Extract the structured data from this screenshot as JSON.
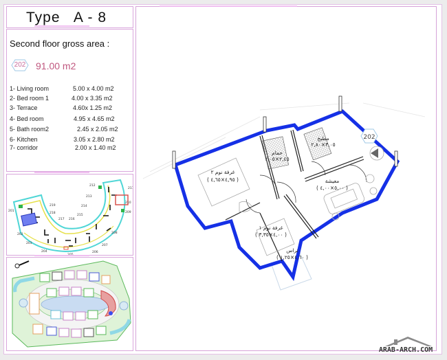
{
  "header": {
    "title": "Type   A - 8"
  },
  "area": {
    "heading": "Second floor gross area :",
    "unit_badge": "202",
    "gross_area": "91.00 m2"
  },
  "rooms": [
    {
      "label": "1- Living room",
      "dims": "5.00 x 4.00 m2"
    },
    {
      "label": "2- Bed room 1",
      "dims": "4.00 x 3.35 m2"
    },
    {
      "label": "3- Terrace",
      "dims": "4.60x 1.25 m2"
    },
    {
      "label": "4- Bed room",
      "dims": "4.95 x 4.65 m2"
    },
    {
      "label": "5- Bath room2",
      "dims": "2.45 x 2.05 m2"
    },
    {
      "label": "6- Kitchen",
      "dims": "3.05 x 2.80 m2"
    },
    {
      "label": "7- corridor",
      "dims": "2.00 x 1.40 m2"
    }
  ],
  "keyplan": {
    "unit_labels": [
      "201",
      "202",
      "203",
      "204",
      "205",
      "206",
      "207",
      "208",
      "209",
      "210",
      "211",
      "212",
      "213",
      "214",
      "215",
      "216",
      "217",
      "218",
      "219"
    ],
    "highlighted_unit": "202",
    "colors": {
      "unit_highlight": "#6f7ef0",
      "ring_outer": "#4fd6d6",
      "ring_inner": "#e6e04a",
      "walls": "#111111",
      "accent_red": "#d9534f",
      "accent_green": "#2fb44a"
    }
  },
  "siteplan": {
    "colors": {
      "grass": "#c9ecc0",
      "pool": "#cfe2f2",
      "path": "#f4f4f4",
      "highlight": "#3b4cf0",
      "hatch": "#d24a4a"
    }
  },
  "floorplan": {
    "unit_marker": "202",
    "wall_color": "#1530e6",
    "room_labels": [
      {
        "name": "غرفة نوم ٢",
        "dims": "( ٤,٩٥×٤,٦٥ )"
      },
      {
        "name": "حمام",
        "dims": "٢,٤٥×٢,٠٥"
      },
      {
        "name": "مطبخ",
        "dims": "٣,٠٥×٢,٨٠"
      },
      {
        "name": "معيشة",
        "dims": "( ٥,٠٠×٤,٠٠ )"
      },
      {
        "name": "غرفة نوم ١",
        "dims": "( ٤,٠٠×٣,٣٥ )"
      },
      {
        "name": "تراس",
        "dims": "( ٤,٦٠×١,٢٥ )"
      }
    ]
  },
  "watermark": {
    "text": "ARAB-ARCH.COM"
  }
}
